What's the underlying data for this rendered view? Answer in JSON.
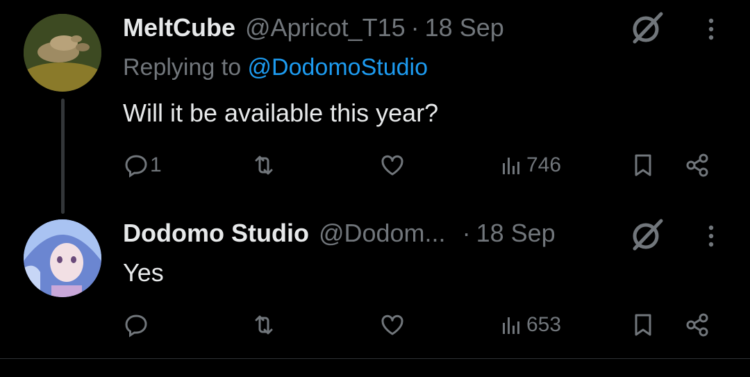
{
  "tweets": [
    {
      "author_name": "MeltCube",
      "author_handle": "@Apricot_T15",
      "separator": "·",
      "date": "18 Sep",
      "replying_prefix": "Replying to ",
      "replying_to": "@DodomoStudio",
      "text": "Will it be available this year?",
      "reply_count": "1",
      "views": "746",
      "avatar_icon": "turtle-avatar"
    },
    {
      "author_name": "Dodomo Studio",
      "author_handle": "@Dodom...",
      "separator": "·",
      "date": "18 Sep",
      "text": "Yes",
      "reply_count": "",
      "views": "653",
      "avatar_icon": "anime-character-avatar"
    }
  ],
  "icons": [
    "grok-icon",
    "more-icon",
    "reply-icon",
    "retweet-icon",
    "like-icon",
    "views-icon",
    "bookmark-icon",
    "share-icon"
  ],
  "colors": {
    "background": "#000000",
    "text": "#e7e9ea",
    "muted": "#71767b",
    "link": "#1d9bf0",
    "thread_line": "#333639"
  }
}
